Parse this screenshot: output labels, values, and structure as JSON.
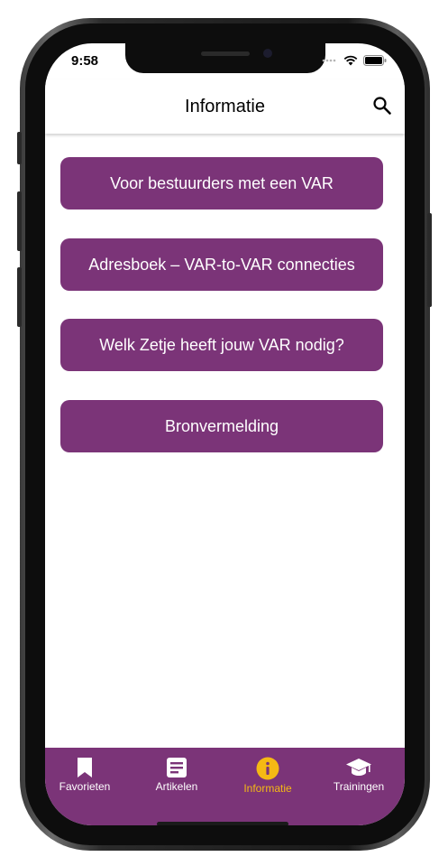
{
  "status": {
    "time": "9:58"
  },
  "appbar": {
    "title": "Informatie"
  },
  "menu": [
    {
      "label": "Voor bestuurders met een VAR"
    },
    {
      "label": "Adresboek – VAR-to-VAR connecties"
    },
    {
      "label": "Welk Zetje heeft jouw VAR nodig?"
    },
    {
      "label": "Bronvermelding"
    }
  ],
  "tabs": [
    {
      "label": "Favorieten",
      "icon": "bookmark-icon",
      "active": false
    },
    {
      "label": "Artikelen",
      "icon": "article-icon",
      "active": false
    },
    {
      "label": "Informatie",
      "icon": "info-icon",
      "active": true
    },
    {
      "label": "Trainingen",
      "icon": "graduation-cap-icon",
      "active": false
    }
  ],
  "colors": {
    "brand": "#7b3478",
    "active_tab": "#f5b914",
    "text_on_brand": "#ffffff"
  }
}
